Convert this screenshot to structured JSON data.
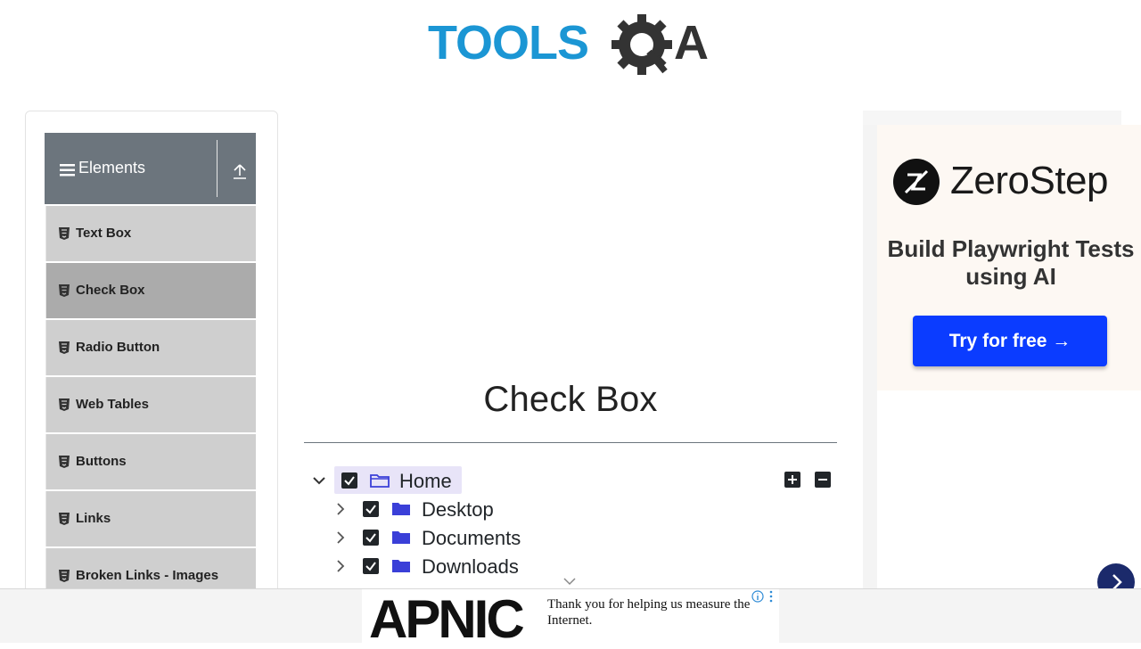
{
  "header": {
    "logo_text": "TOOLSQA",
    "logo_colors": {
      "tools": "#1b96d4",
      "qa": "#333333"
    }
  },
  "sidebar": {
    "group_title": "Elements",
    "items": [
      {
        "label": "Text Box",
        "active": false
      },
      {
        "label": "Check Box",
        "active": true
      },
      {
        "label": "Radio Button",
        "active": false
      },
      {
        "label": "Web Tables",
        "active": false
      },
      {
        "label": "Buttons",
        "active": false
      },
      {
        "label": "Links",
        "active": false
      },
      {
        "label": "Broken Links - Images",
        "active": false
      }
    ]
  },
  "main": {
    "title": "Check Box",
    "tree": {
      "root": {
        "label": "Home",
        "checked": true,
        "expanded": true,
        "icon": "folder-open-icon"
      },
      "children": [
        {
          "label": "Desktop",
          "checked": true,
          "expanded": false,
          "icon": "folder-icon"
        },
        {
          "label": "Documents",
          "checked": true,
          "expanded": false,
          "icon": "folder-icon"
        },
        {
          "label": "Downloads",
          "checked": true,
          "expanded": false,
          "icon": "folder-icon"
        }
      ],
      "expand_all_icon": "plus-square-icon",
      "collapse_all_icon": "minus-square-icon"
    }
  },
  "ad_right": {
    "brand": "ZeroStep",
    "tagline": "Build Playwright Tests using AI",
    "cta": "Try for free →",
    "cta_color": "#0b3cff"
  },
  "ad_bottom": {
    "brand": "APNIC",
    "message": "Thank you for helping us measure the Internet."
  },
  "colors": {
    "sidebar_header": "#6c757d",
    "menu_item": "#cfcfcf",
    "menu_item_active": "#ababab",
    "folder": "#3a3fd8",
    "checkbox": "#212529"
  }
}
